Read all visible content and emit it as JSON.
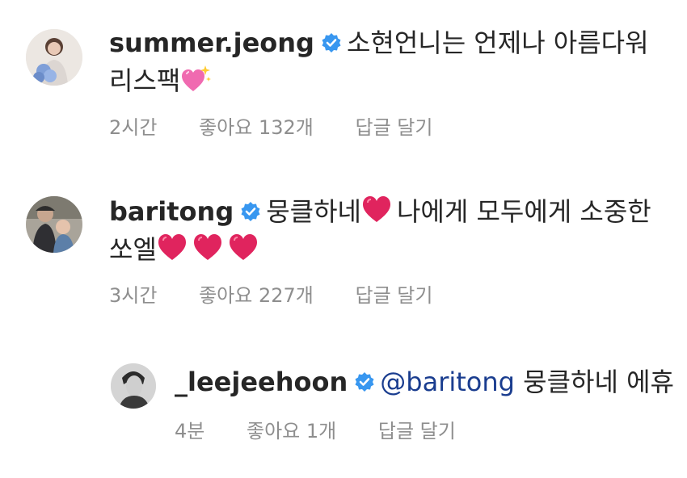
{
  "comments": [
    {
      "username": "summer.jeong",
      "text_line1": "소현언니는 언제나 아름다워",
      "text_line2": "리스팩",
      "time": "2시간",
      "likes": "좋아요 132개",
      "reply": "답글 달기",
      "avatar_icon": "profile-photo-woman-with-flowers"
    },
    {
      "username": "baritong",
      "text_part1": "뭉클하네",
      "text_part2": "나에게 모두에게 소중한",
      "text_line2": "쏘엘",
      "time": "3시간",
      "likes": "좋아요 227개",
      "reply": "답글 달기",
      "avatar_icon": "profile-photo-man-with-child"
    }
  ],
  "reply": {
    "username": "_leejeehoon",
    "mention": "@baritong",
    "text": "뭉클하네 에휴",
    "time": "4분",
    "likes": "좋아요 1개",
    "reply": "답글 달기",
    "avatar_icon": "profile-photo-man-portrait"
  },
  "colors": {
    "verified_badge": "#3897f0",
    "heart": "#e0245e",
    "mention_link": "#1a3d8f",
    "meta_text": "#8e8e8e"
  }
}
